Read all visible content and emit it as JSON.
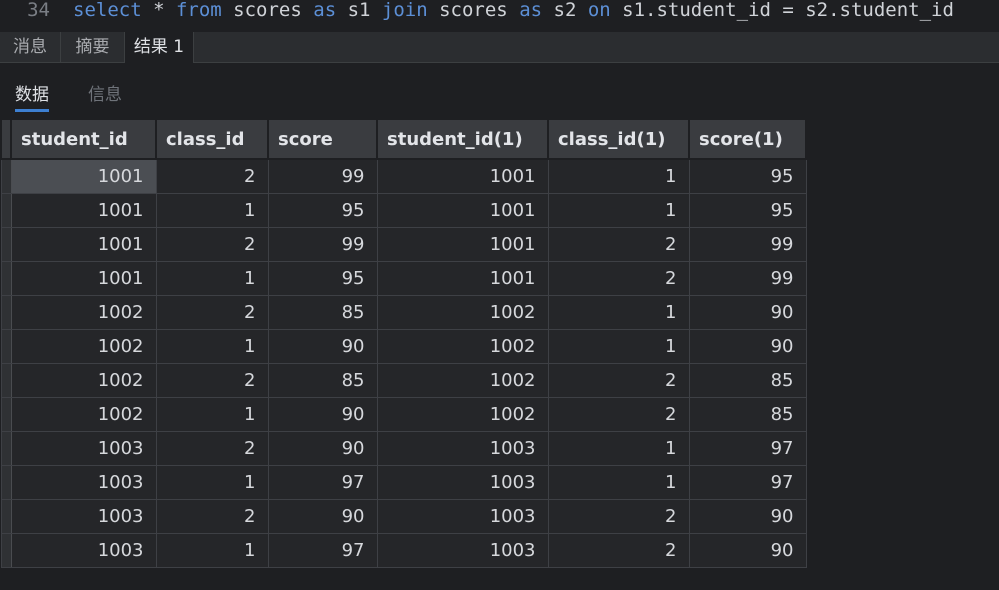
{
  "editor": {
    "line_number": "34",
    "query_parts": [
      {
        "t": "select",
        "k": true
      },
      {
        "t": " * ",
        "k": false
      },
      {
        "t": "from",
        "k": true
      },
      {
        "t": " scores ",
        "k": false
      },
      {
        "t": "as",
        "k": true
      },
      {
        "t": " s1 ",
        "k": false
      },
      {
        "t": "join",
        "k": true
      },
      {
        "t": " scores ",
        "k": false
      },
      {
        "t": "as",
        "k": true
      },
      {
        "t": " s2 ",
        "k": false
      },
      {
        "t": "on",
        "k": true
      },
      {
        "t": " s1.student_id = s2.student_id",
        "k": false
      }
    ]
  },
  "tabs": [
    {
      "label": "消息",
      "active": false
    },
    {
      "label": "摘要",
      "active": false
    },
    {
      "label": "结果 1",
      "active": true
    }
  ],
  "subtabs": [
    {
      "label": "数据",
      "active": true
    },
    {
      "label": "信息",
      "active": false
    }
  ],
  "grid": {
    "columns": [
      "student_id",
      "class_id",
      "score",
      "student_id(1)",
      "class_id(1)",
      "score(1)"
    ],
    "rows": [
      [
        "1001",
        "2",
        "99",
        "1001",
        "1",
        "95"
      ],
      [
        "1001",
        "1",
        "95",
        "1001",
        "1",
        "95"
      ],
      [
        "1001",
        "2",
        "99",
        "1001",
        "2",
        "99"
      ],
      [
        "1001",
        "1",
        "95",
        "1001",
        "2",
        "99"
      ],
      [
        "1002",
        "2",
        "85",
        "1002",
        "1",
        "90"
      ],
      [
        "1002",
        "1",
        "90",
        "1002",
        "1",
        "90"
      ],
      [
        "1002",
        "2",
        "85",
        "1002",
        "2",
        "85"
      ],
      [
        "1002",
        "1",
        "90",
        "1002",
        "2",
        "85"
      ],
      [
        "1003",
        "2",
        "90",
        "1003",
        "1",
        "97"
      ],
      [
        "1003",
        "1",
        "97",
        "1003",
        "1",
        "97"
      ],
      [
        "1003",
        "2",
        "90",
        "1003",
        "2",
        "90"
      ],
      [
        "1003",
        "1",
        "97",
        "1003",
        "2",
        "90"
      ]
    ],
    "selected_row": 0
  }
}
